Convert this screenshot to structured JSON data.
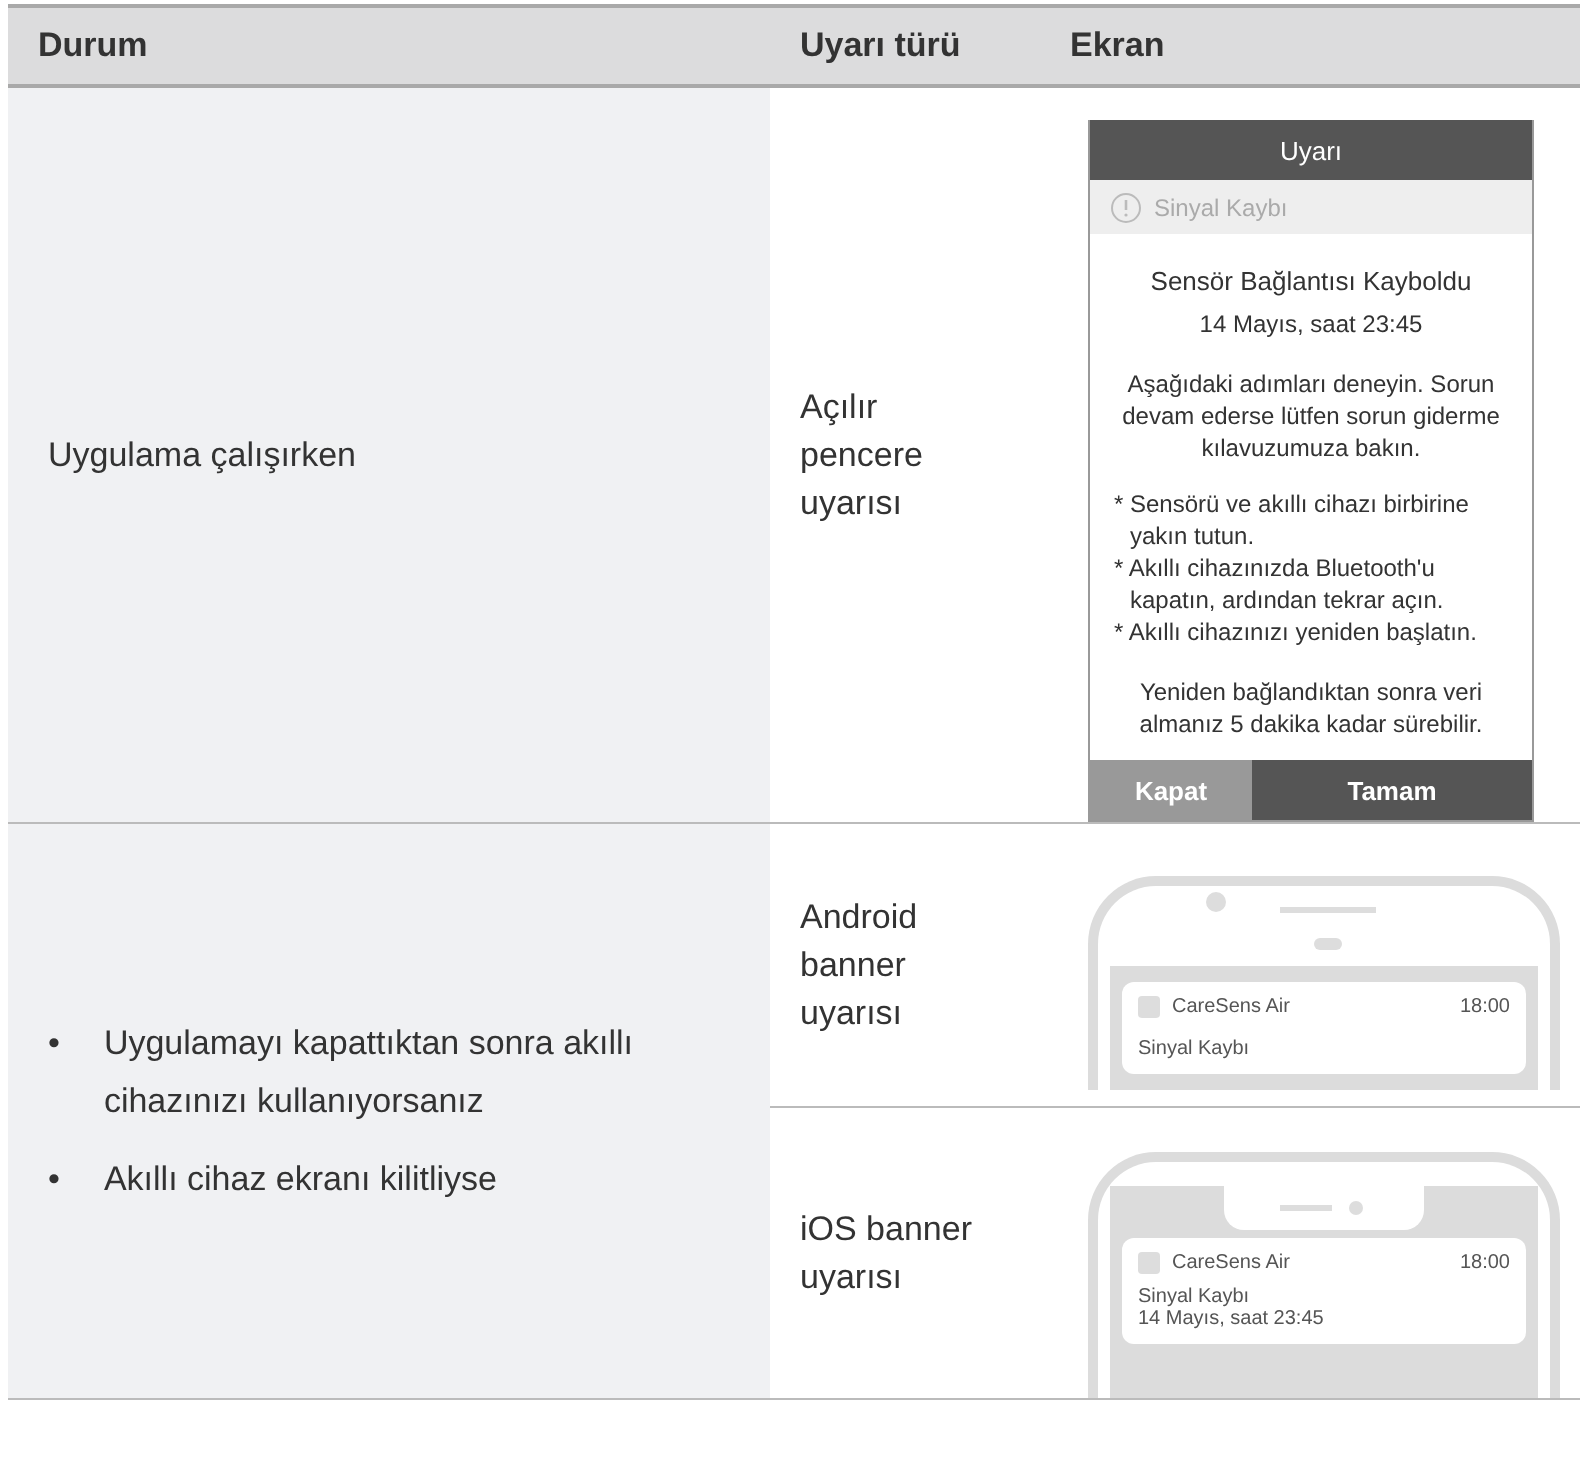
{
  "columns": [
    "Durum",
    "Uyarı türü",
    "Ekran"
  ],
  "rows": [
    {
      "condition": [
        {
          "text": "Uygulama çalışırken"
        }
      ],
      "alerts": [
        {
          "kind": "popup",
          "type": "Açılır pencere uyarısı",
          "screen": {
            "title": "Uyarı",
            "subtitle": "Sinyal Kaybı",
            "heading": "Sensör Bağlantısı Kayboldu",
            "date": "14 Mayıs, saat 23:45",
            "message": "Aşağıdaki adımları deneyin. Sorun devam ederse lütfen sorun giderme kılavuzumuza bakın.",
            "steps": [
              "* Sensörü ve akıllı cihazı birbirine yakın tutun.",
              "* Akıllı cihazınızda Bluetooth'u kapatın, ardından tekrar açın.",
              "* Akıllı cihazınızı yeniden başlatın."
            ],
            "note": "Yeniden bağlandıktan sonra veri almanız 5 dakika kadar sürebilir.",
            "buttons": [
              "Kapat",
              "Tamam"
            ]
          }
        }
      ]
    },
    {
      "condition": [
        {
          "marker": "•",
          "text": "Uygulamayı kapattıktan sonra akıllı cihazınızı kullanıyorsanız"
        },
        {
          "marker": "•",
          "text": "Akıllı cihaz ekranı kilitliyse"
        }
      ],
      "alerts": [
        {
          "kind": "android",
          "type": "Android banner uyarısı",
          "screen": {
            "app": "CareSens Air",
            "time": "18:00",
            "lines": [
              "Sinyal Kaybı"
            ]
          }
        },
        {
          "kind": "ios",
          "type": "iOS banner uyarısı",
          "screen": {
            "app": "CareSens Air",
            "time": "18:00",
            "lines": [
              "Sinyal Kaybı",
              "14 Mayıs, saat 23:45"
            ]
          }
        }
      ]
    }
  ]
}
